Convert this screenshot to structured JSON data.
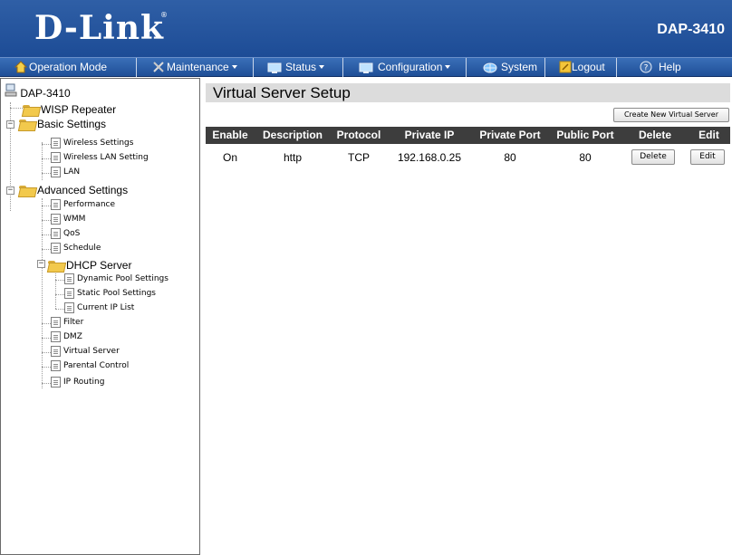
{
  "header": {
    "logo": "D-Link",
    "logo_mark": "®",
    "model": "DAP-3410"
  },
  "menu": [
    {
      "label": "Operation Mode",
      "icon": "home-icon",
      "dropdown": false
    },
    {
      "label": "Maintenance",
      "icon": "tools-icon",
      "dropdown": true
    },
    {
      "label": "Status",
      "icon": "monitor-icon",
      "dropdown": true
    },
    {
      "label": "Configuration",
      "icon": "monitor-icon",
      "dropdown": true
    },
    {
      "label": "System",
      "icon": "network-icon",
      "dropdown": false
    },
    {
      "label": "Logout",
      "icon": "logout-icon",
      "dropdown": false
    },
    {
      "label": "Help",
      "icon": "help-icon",
      "dropdown": false
    }
  ],
  "tree": {
    "root": "DAP-3410",
    "wisp": "WISP Repeater",
    "basic": "Basic Settings",
    "basic_items": [
      "Wireless Settings",
      "Wireless LAN Setting",
      "LAN"
    ],
    "advanced": "Advanced Settings",
    "advanced_items_a": [
      "Performance",
      "WMM",
      "QoS",
      "Schedule"
    ],
    "dhcp": "DHCP Server",
    "dhcp_items": [
      "Dynamic Pool Settings",
      "Static Pool Settings",
      "Current IP List"
    ],
    "advanced_items_b": [
      "Filter",
      "DMZ",
      "Virtual Server",
      "Parental Control",
      "IP Routing"
    ],
    "expand_symbol": "−"
  },
  "main": {
    "title": "Virtual Server Setup",
    "create_button": "Create New Virtual Server",
    "columns": [
      "Enable",
      "Description",
      "Protocol",
      "Private IP",
      "Private Port",
      "Public Port",
      "Delete",
      "Edit"
    ],
    "rows": [
      {
        "enable": "On",
        "description": "http",
        "protocol": "TCP",
        "private_ip": "192.168.0.25",
        "private_port": "80",
        "public_port": "80",
        "delete_label": "Delete",
        "edit_label": "Edit"
      }
    ]
  },
  "colors": {
    "header_blue": "#2f5fa6",
    "table_header": "#3d3d3d",
    "title_bar": "#dcdcdc"
  }
}
